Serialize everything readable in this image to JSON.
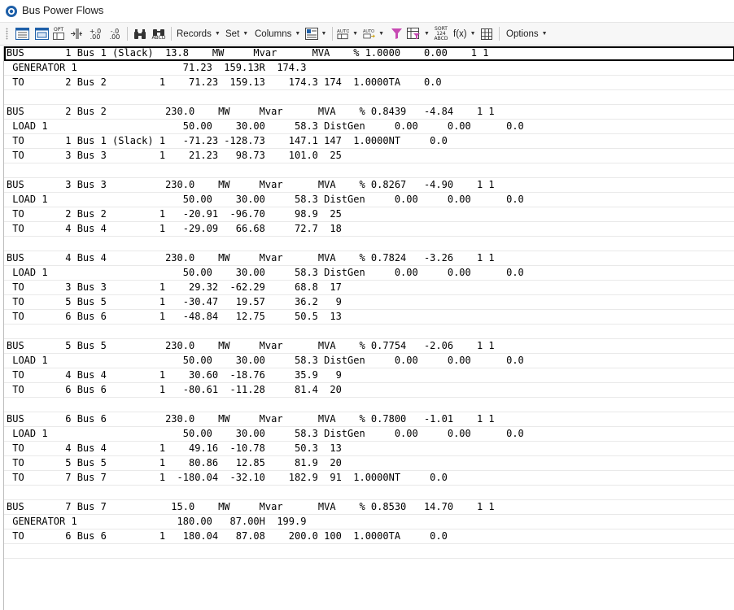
{
  "window": {
    "title": "Bus Power Flows"
  },
  "toolbar": {
    "records_label": "Records",
    "set_label": "Set",
    "columns_label": "Columns",
    "fx_label": "f(x)",
    "options_label": "Options",
    "icons": [
      "sheet-view-icon",
      "sheet-view2-icon",
      "opt-icon",
      "insert-column-icon",
      "increase-decimals-icon",
      "decrease-decimals-icon",
      "find-icon",
      "find-abcd-icon",
      "export-icon",
      "auto-size-icon",
      "auto-size2-icon",
      "filter-icon",
      "advanced-filter-icon",
      "sort-icon",
      "fx-icon",
      "grid-icon"
    ],
    "small_labels": {
      "opt": "OPT",
      "inc": "+.0\n.00",
      "dec": "-.0\n.00",
      "abcd": "ABCD",
      "sort": "SORT\n124\nABCD"
    }
  },
  "report_lines": [
    "BUS       1 Bus 1 (Slack)  13.8    MW     Mvar      MVA    % 1.0000    0.00    1 1",
    " GENERATOR 1                  71.23  159.13R  174.3",
    " TO       2 Bus 2         1    71.23  159.13    174.3 174  1.0000TA    0.0",
    "",
    "BUS       2 Bus 2          230.0    MW     Mvar      MVA    % 0.8439   -4.84    1 1",
    " LOAD 1                       50.00    30.00     58.3 DistGen     0.00     0.00      0.0",
    " TO       1 Bus 1 (Slack) 1   -71.23 -128.73    147.1 147  1.0000NT     0.0",
    " TO       3 Bus 3         1    21.23   98.73    101.0  25",
    "",
    "BUS       3 Bus 3          230.0    MW     Mvar      MVA    % 0.8267   -4.90    1 1",
    " LOAD 1                       50.00    30.00     58.3 DistGen     0.00     0.00      0.0",
    " TO       2 Bus 2         1   -20.91  -96.70     98.9  25",
    " TO       4 Bus 4         1   -29.09   66.68     72.7  18",
    "",
    "BUS       4 Bus 4          230.0    MW     Mvar      MVA    % 0.7824   -3.26    1 1",
    " LOAD 1                       50.00    30.00     58.3 DistGen     0.00     0.00      0.0",
    " TO       3 Bus 3         1    29.32  -62.29     68.8  17",
    " TO       5 Bus 5         1   -30.47   19.57     36.2   9",
    " TO       6 Bus 6         1   -48.84   12.75     50.5  13",
    "",
    "BUS       5 Bus 5          230.0    MW     Mvar      MVA    % 0.7754   -2.06    1 1",
    " LOAD 1                       50.00    30.00     58.3 DistGen     0.00     0.00      0.0",
    " TO       4 Bus 4         1    30.60  -18.76     35.9   9",
    " TO       6 Bus 6         1   -80.61  -11.28     81.4  20",
    "",
    "BUS       6 Bus 6          230.0    MW     Mvar      MVA    % 0.7800   -1.01    1 1",
    " LOAD 1                       50.00    30.00     58.3 DistGen     0.00     0.00      0.0",
    " TO       4 Bus 4         1    49.16  -10.78     50.3  13",
    " TO       5 Bus 5         1    80.86   12.85     81.9  20",
    " TO       7 Bus 7         1  -180.04  -32.10    182.9  91  1.0000NT     0.0",
    "",
    "BUS       7 Bus 7           15.0    MW     Mvar      MVA    % 0.8530   14.70    1 1",
    " GENERATOR 1                 180.00   87.00H  199.9",
    " TO       6 Bus 6         1   180.04   87.08    200.0 100  1.0000TA     0.0",
    ""
  ],
  "colors": {
    "accent": "#1e5fa8",
    "filter": "#c74ab3",
    "selection": "#000000"
  }
}
